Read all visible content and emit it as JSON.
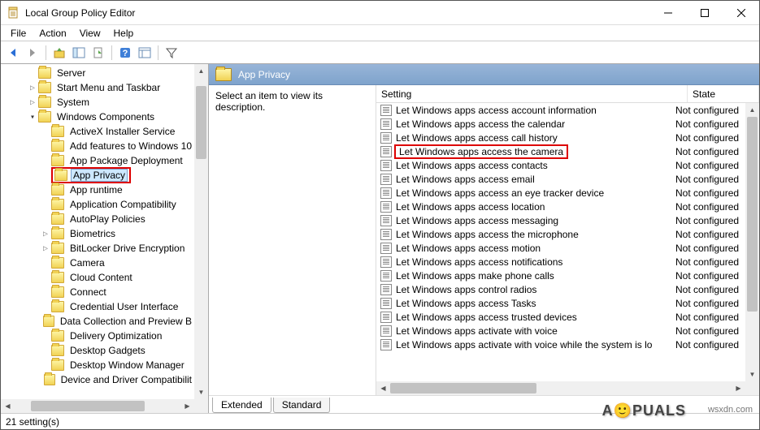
{
  "window": {
    "title": "Local Group Policy Editor"
  },
  "menu": [
    "File",
    "Action",
    "View",
    "Help"
  ],
  "tree": [
    {
      "level": 2,
      "twisty": "",
      "label": "Server"
    },
    {
      "level": 2,
      "twisty": ">",
      "label": "Start Menu and Taskbar"
    },
    {
      "level": 2,
      "twisty": ">",
      "label": "System"
    },
    {
      "level": 2,
      "twisty": "v",
      "label": "Windows Components"
    },
    {
      "level": 3,
      "twisty": "",
      "label": "ActiveX Installer Service"
    },
    {
      "level": 3,
      "twisty": "",
      "label": "Add features to Windows 10"
    },
    {
      "level": 3,
      "twisty": "",
      "label": "App Package Deployment"
    },
    {
      "level": 3,
      "twisty": "",
      "label": "App Privacy",
      "selected": true,
      "red": true
    },
    {
      "level": 3,
      "twisty": "",
      "label": "App runtime"
    },
    {
      "level": 3,
      "twisty": "",
      "label": "Application Compatibility"
    },
    {
      "level": 3,
      "twisty": "",
      "label": "AutoPlay Policies"
    },
    {
      "level": 3,
      "twisty": ">",
      "label": "Biometrics"
    },
    {
      "level": 3,
      "twisty": ">",
      "label": "BitLocker Drive Encryption"
    },
    {
      "level": 3,
      "twisty": "",
      "label": "Camera"
    },
    {
      "level": 3,
      "twisty": "",
      "label": "Cloud Content"
    },
    {
      "level": 3,
      "twisty": "",
      "label": "Connect"
    },
    {
      "level": 3,
      "twisty": "",
      "label": "Credential User Interface"
    },
    {
      "level": 3,
      "twisty": "",
      "label": "Data Collection and Preview B"
    },
    {
      "level": 3,
      "twisty": "",
      "label": "Delivery Optimization"
    },
    {
      "level": 3,
      "twisty": "",
      "label": "Desktop Gadgets"
    },
    {
      "level": 3,
      "twisty": "",
      "label": "Desktop Window Manager"
    },
    {
      "level": 3,
      "twisty": "",
      "label": "Device and Driver Compatibilit"
    }
  ],
  "right": {
    "header": "App Privacy",
    "desc": "Select an item to view its description.",
    "cols": {
      "setting": "Setting",
      "state": "State"
    },
    "settings": [
      {
        "name": "Let Windows apps access account information",
        "state": "Not configured"
      },
      {
        "name": "Let Windows apps access the calendar",
        "state": "Not configured"
      },
      {
        "name": "Let Windows apps access call history",
        "state": "Not configured"
      },
      {
        "name": "Let Windows apps access the camera",
        "state": "Not configured",
        "red": true
      },
      {
        "name": "Let Windows apps access contacts",
        "state": "Not configured"
      },
      {
        "name": "Let Windows apps access email",
        "state": "Not configured"
      },
      {
        "name": "Let Windows apps access an eye tracker device",
        "state": "Not configured"
      },
      {
        "name": "Let Windows apps access location",
        "state": "Not configured"
      },
      {
        "name": "Let Windows apps access messaging",
        "state": "Not configured"
      },
      {
        "name": "Let Windows apps access the microphone",
        "state": "Not configured"
      },
      {
        "name": "Let Windows apps access motion",
        "state": "Not configured"
      },
      {
        "name": "Let Windows apps access notifications",
        "state": "Not configured"
      },
      {
        "name": "Let Windows apps make phone calls",
        "state": "Not configured"
      },
      {
        "name": "Let Windows apps control radios",
        "state": "Not configured"
      },
      {
        "name": "Let Windows apps access Tasks",
        "state": "Not configured"
      },
      {
        "name": "Let Windows apps access trusted devices",
        "state": "Not configured"
      },
      {
        "name": "Let Windows apps activate with voice",
        "state": "Not configured"
      },
      {
        "name": "Let Windows apps activate with voice while the system is lo",
        "state": "Not configured"
      }
    ]
  },
  "tabs": {
    "extended": "Extended",
    "standard": "Standard"
  },
  "status": "21 setting(s)",
  "watermark": "wsxdn.com",
  "logo_parts": {
    "a": "A",
    "p": "PUALS"
  }
}
